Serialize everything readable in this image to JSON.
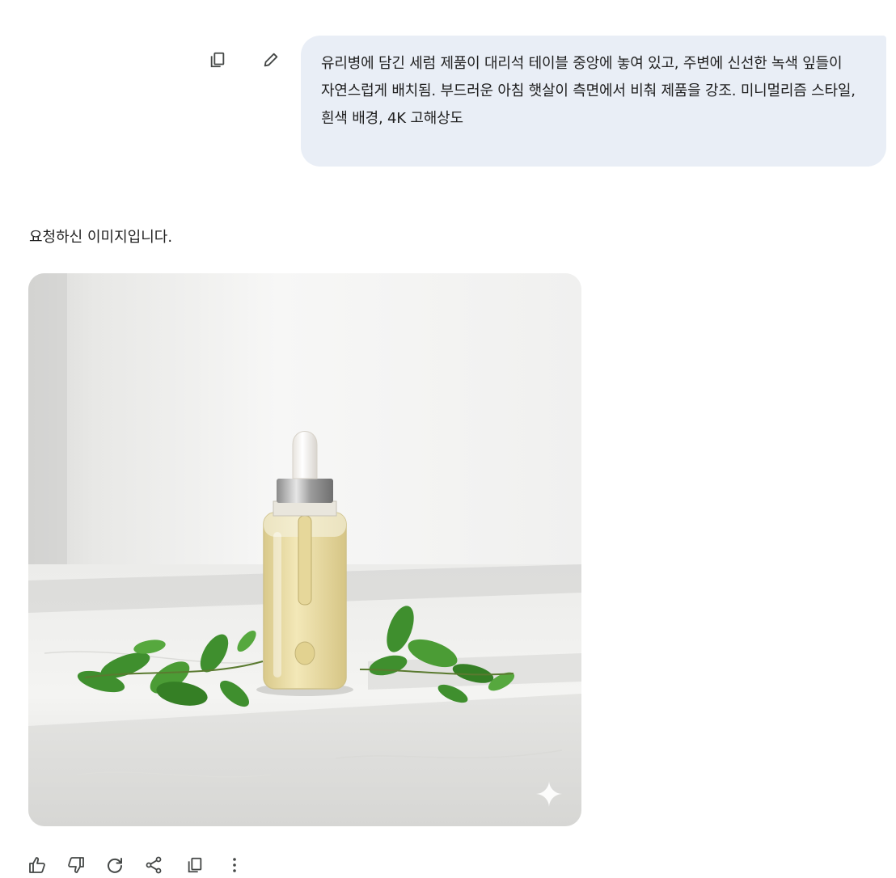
{
  "user_message": {
    "text": "유리병에 담긴 세럼 제품이 대리석 테이블 중앙에 놓여 있고, 주변에 신선한 녹색 잎들이 자연스럽게 배치됨. 부드러운 아침 햇살이 측면에서 비춰 제품을 강조. 미니멀리즘 스타일, 흰색 배경, 4K 고해상도",
    "actions": [
      "copy-icon",
      "edit-icon"
    ]
  },
  "response": {
    "text": "요청하신 이미지입니다.",
    "image_badge": "sparkle-icon",
    "actions": [
      "thumb-up-icon",
      "thumb-down-icon",
      "regenerate-icon",
      "share-icon",
      "copy-icon",
      "more-vert-icon"
    ]
  },
  "colors": {
    "bubble_bg": "#e9eef6",
    "text": "#1f1f1f",
    "icon": "#444746",
    "leaf": "#3f8f2e",
    "serum": "#ecdca0"
  }
}
